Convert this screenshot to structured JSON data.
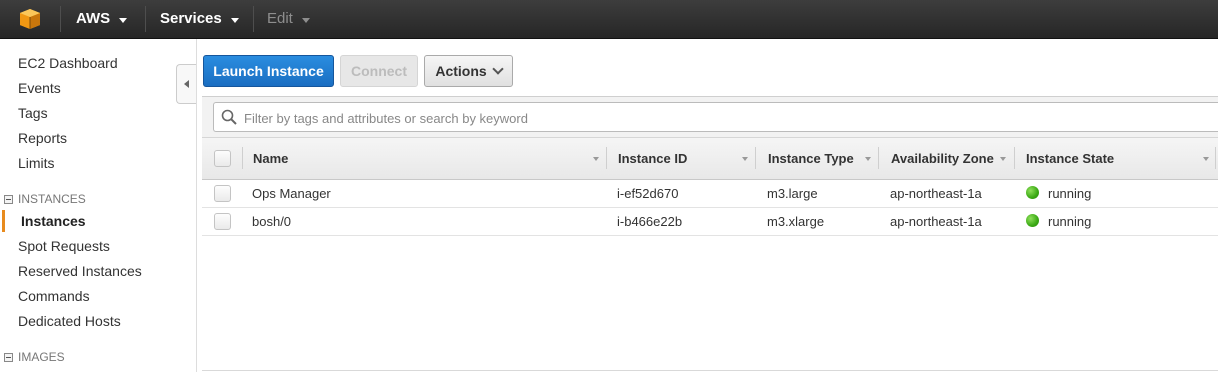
{
  "topnav": {
    "logo_icon": "aws-cube-icon",
    "aws_label": "AWS",
    "services_label": "Services",
    "edit_label": "Edit"
  },
  "sidebar": {
    "items_top": [
      "EC2 Dashboard",
      "Events",
      "Tags",
      "Reports",
      "Limits"
    ],
    "instances_section": "INSTANCES",
    "instances_items": [
      "Instances",
      "Spot Requests",
      "Reserved Instances",
      "Commands",
      "Dedicated Hosts"
    ],
    "images_section": "IMAGES",
    "active_item": "Instances",
    "active_color": "#e88b1e"
  },
  "toolbar": {
    "launch_label": "Launch Instance",
    "connect_label": "Connect",
    "actions_label": "Actions"
  },
  "filter": {
    "placeholder": "Filter by tags and attributes or search by keyword",
    "icon": "search-icon"
  },
  "table": {
    "columns": [
      "Name",
      "Instance ID",
      "Instance Type",
      "Availability Zone",
      "Instance State"
    ],
    "rows": [
      {
        "name": "Ops Manager",
        "id": "i-ef52d670",
        "type": "m3.large",
        "zone": "ap-northeast-1a",
        "state": "running"
      },
      {
        "name": "bosh/0",
        "id": "i-b466e22b",
        "type": "m3.xlarge",
        "zone": "ap-northeast-1a",
        "state": "running"
      }
    ],
    "state_color": "#3aa814"
  }
}
